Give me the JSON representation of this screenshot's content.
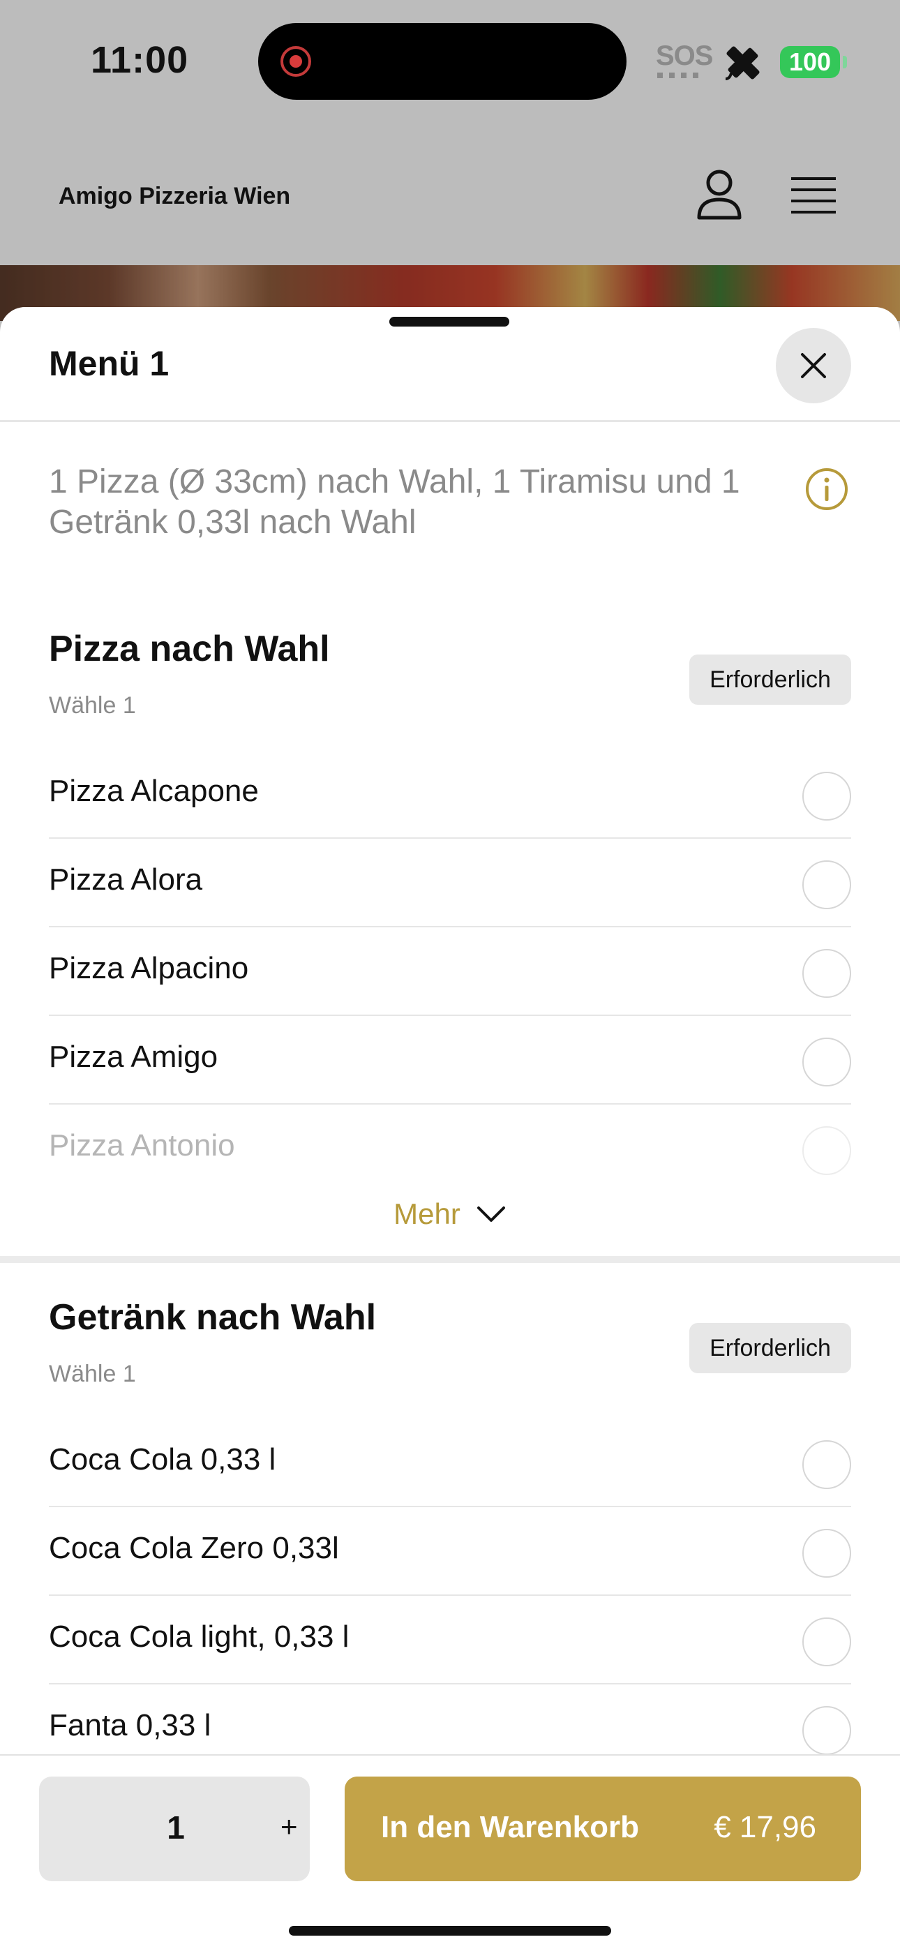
{
  "status_bar": {
    "time": "11:00",
    "sos": "SOS",
    "battery": "100"
  },
  "header": {
    "site_title": "Amigo Pizzeria Wien"
  },
  "sheet": {
    "title": "Menü 1",
    "description": "1 Pizza (Ø 33cm) nach Wahl, 1 Tiramisu und 1 Getränk 0,33l nach Wahl"
  },
  "groups": [
    {
      "title": "Pizza nach Wahl",
      "subtitle": "Wähle 1",
      "badge": "Erforderlich",
      "options": [
        "Pizza Alcapone",
        "Pizza Alora",
        "Pizza Alpacino",
        "Pizza Amigo",
        "Pizza Antonio"
      ],
      "more_label": "Mehr"
    },
    {
      "title": "Getränk nach Wahl",
      "subtitle": "Wähle 1",
      "badge": "Erforderlich",
      "options": [
        "Coca Cola 0,33 l",
        "Coca Cola Zero 0,33l",
        "Coca Cola light, 0,33 l",
        "Fanta 0,33 l"
      ]
    }
  ],
  "footer": {
    "quantity": "1",
    "plus": "+",
    "cart_label": "In den Warenkorb",
    "price": "€ 17,96"
  },
  "colors": {
    "accent": "#c3a348",
    "accent_text": "#b69a3a",
    "battery": "#34c759"
  }
}
